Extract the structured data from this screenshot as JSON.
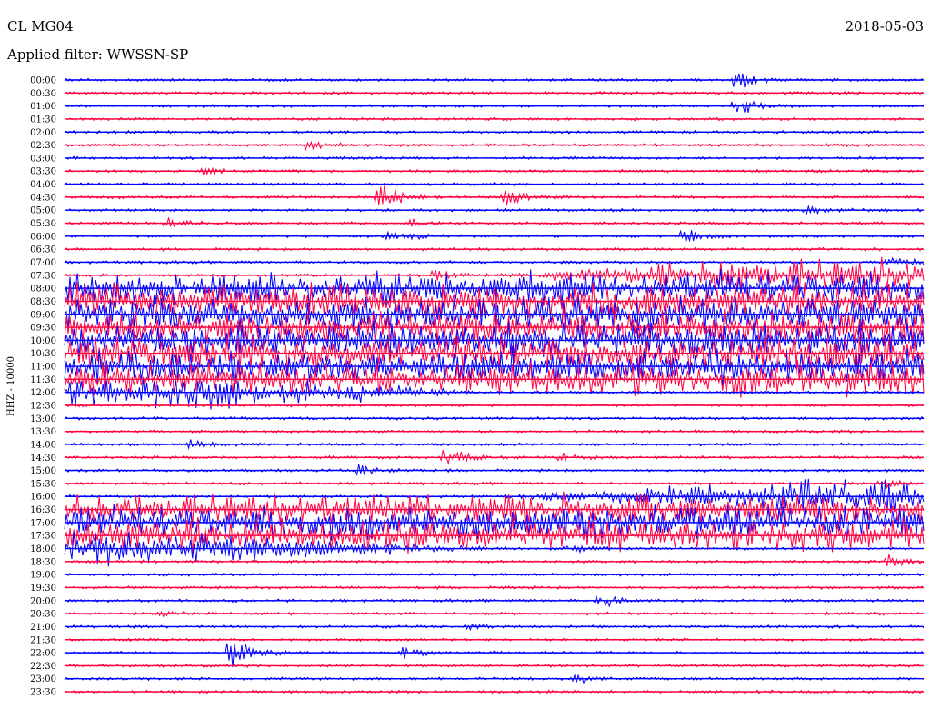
{
  "header": {
    "station": "CL MG04",
    "date": "2018-05-03",
    "filter": "Applied filter: WWSSN-SP"
  },
  "chart_data": {
    "type": "line",
    "title": "CL MG04",
    "subtitle": "Applied filter: WWSSN-SP",
    "date": "2018-05-03",
    "ylabel": "HHZ - 10000",
    "xlabel": "",
    "row_labels": [
      "00:00",
      "00:30",
      "01:00",
      "01:30",
      "02:00",
      "02:30",
      "03:00",
      "03:30",
      "04:00",
      "04:30",
      "05:00",
      "05:30",
      "06:00",
      "06:30",
      "07:00",
      "07:30",
      "08:00",
      "08:30",
      "09:00",
      "09:30",
      "10:00",
      "10:30",
      "11:00",
      "11:30",
      "12:00",
      "12:30",
      "13:00",
      "13:30",
      "14:00",
      "14:30",
      "15:00",
      "15:30",
      "16:00",
      "16:30",
      "17:00",
      "17:30",
      "18:00",
      "18:30",
      "19:00",
      "19:30",
      "20:00",
      "20:30",
      "21:00",
      "21:30",
      "22:00",
      "22:30",
      "23:00",
      "23:30"
    ],
    "colors": [
      "#0000ff",
      "#ff0040"
    ],
    "grid": false,
    "events": [
      {
        "row": "00:00",
        "minute": 23.4,
        "amplitude": 1.5,
        "color_row": "blue"
      },
      {
        "row": "01:00",
        "minute": 23.4,
        "amplitude": 1.2,
        "color_row": "blue"
      },
      {
        "row": "02:30",
        "minute": 8.4,
        "amplitude": 0.6,
        "color_row": "red"
      },
      {
        "row": "03:30",
        "minute": 4.8,
        "amplitude": 0.5,
        "color_row": "red"
      },
      {
        "row": "04:30",
        "minute": 11.0,
        "amplitude": 2.2,
        "color_row": "red"
      },
      {
        "row": "04:30",
        "minute": 15.4,
        "amplitude": 1.1,
        "color_row": "red"
      },
      {
        "row": "05:00",
        "minute": 25.9,
        "amplitude": 0.6,
        "color_row": "blue"
      },
      {
        "row": "05:30",
        "minute": 3.6,
        "amplitude": 0.7,
        "color_row": "red"
      },
      {
        "row": "05:30",
        "minute": 12.0,
        "amplitude": 0.6,
        "color_row": "red"
      },
      {
        "row": "06:00",
        "minute": 11.3,
        "amplitude": 0.9,
        "color_row": "blue"
      },
      {
        "row": "06:00",
        "minute": 21.6,
        "amplitude": 1.0,
        "color_row": "blue"
      },
      {
        "row": "07:00",
        "minute": 28.8,
        "amplitude": 0.9,
        "color_row": "blue"
      },
      {
        "row": "07:30",
        "minute": 12.9,
        "amplitude": 0.8,
        "color_row": "red"
      },
      {
        "row": "07:30",
        "minute": 20.7,
        "amplitude": 0.5,
        "color_row": "red"
      },
      {
        "row": "14:00",
        "minute": 4.4,
        "amplitude": 0.7,
        "color_row": "blue"
      },
      {
        "row": "14:30",
        "minute": 13.3,
        "amplitude": 1.5,
        "color_row": "red"
      },
      {
        "row": "14:30",
        "minute": 17.3,
        "amplitude": 0.5,
        "color_row": "red"
      },
      {
        "row": "15:00",
        "minute": 10.2,
        "amplitude": 0.8,
        "color_row": "blue"
      },
      {
        "row": "15:30",
        "minute": 28.4,
        "amplitude": 0.9,
        "color_row": "red"
      },
      {
        "row": "18:00",
        "minute": 17.6,
        "amplitude": 0.5,
        "color_row": "blue"
      },
      {
        "row": "18:30",
        "minute": 28.7,
        "amplitude": 0.9,
        "color_row": "red"
      },
      {
        "row": "20:00",
        "minute": 18.6,
        "amplitude": 1.0,
        "color_row": "blue"
      },
      {
        "row": "20:30",
        "minute": 3.4,
        "amplitude": 0.3,
        "color_row": "red"
      },
      {
        "row": "21:00",
        "minute": 14.0,
        "amplitude": 0.3,
        "color_row": "blue"
      },
      {
        "row": "22:00",
        "minute": 5.8,
        "amplitude": 2.4,
        "color_row": "blue"
      },
      {
        "row": "22:00",
        "minute": 11.8,
        "amplitude": 0.6,
        "color_row": "blue"
      },
      {
        "row": "23:00",
        "minute": 17.8,
        "amplitude": 0.6,
        "color_row": "blue"
      }
    ],
    "noisy_periods": [
      {
        "start": "08:00",
        "end": "12:00",
        "level": 1.8
      },
      {
        "start": "16:30",
        "end": "18:00",
        "level": 1.7
      }
    ]
  }
}
